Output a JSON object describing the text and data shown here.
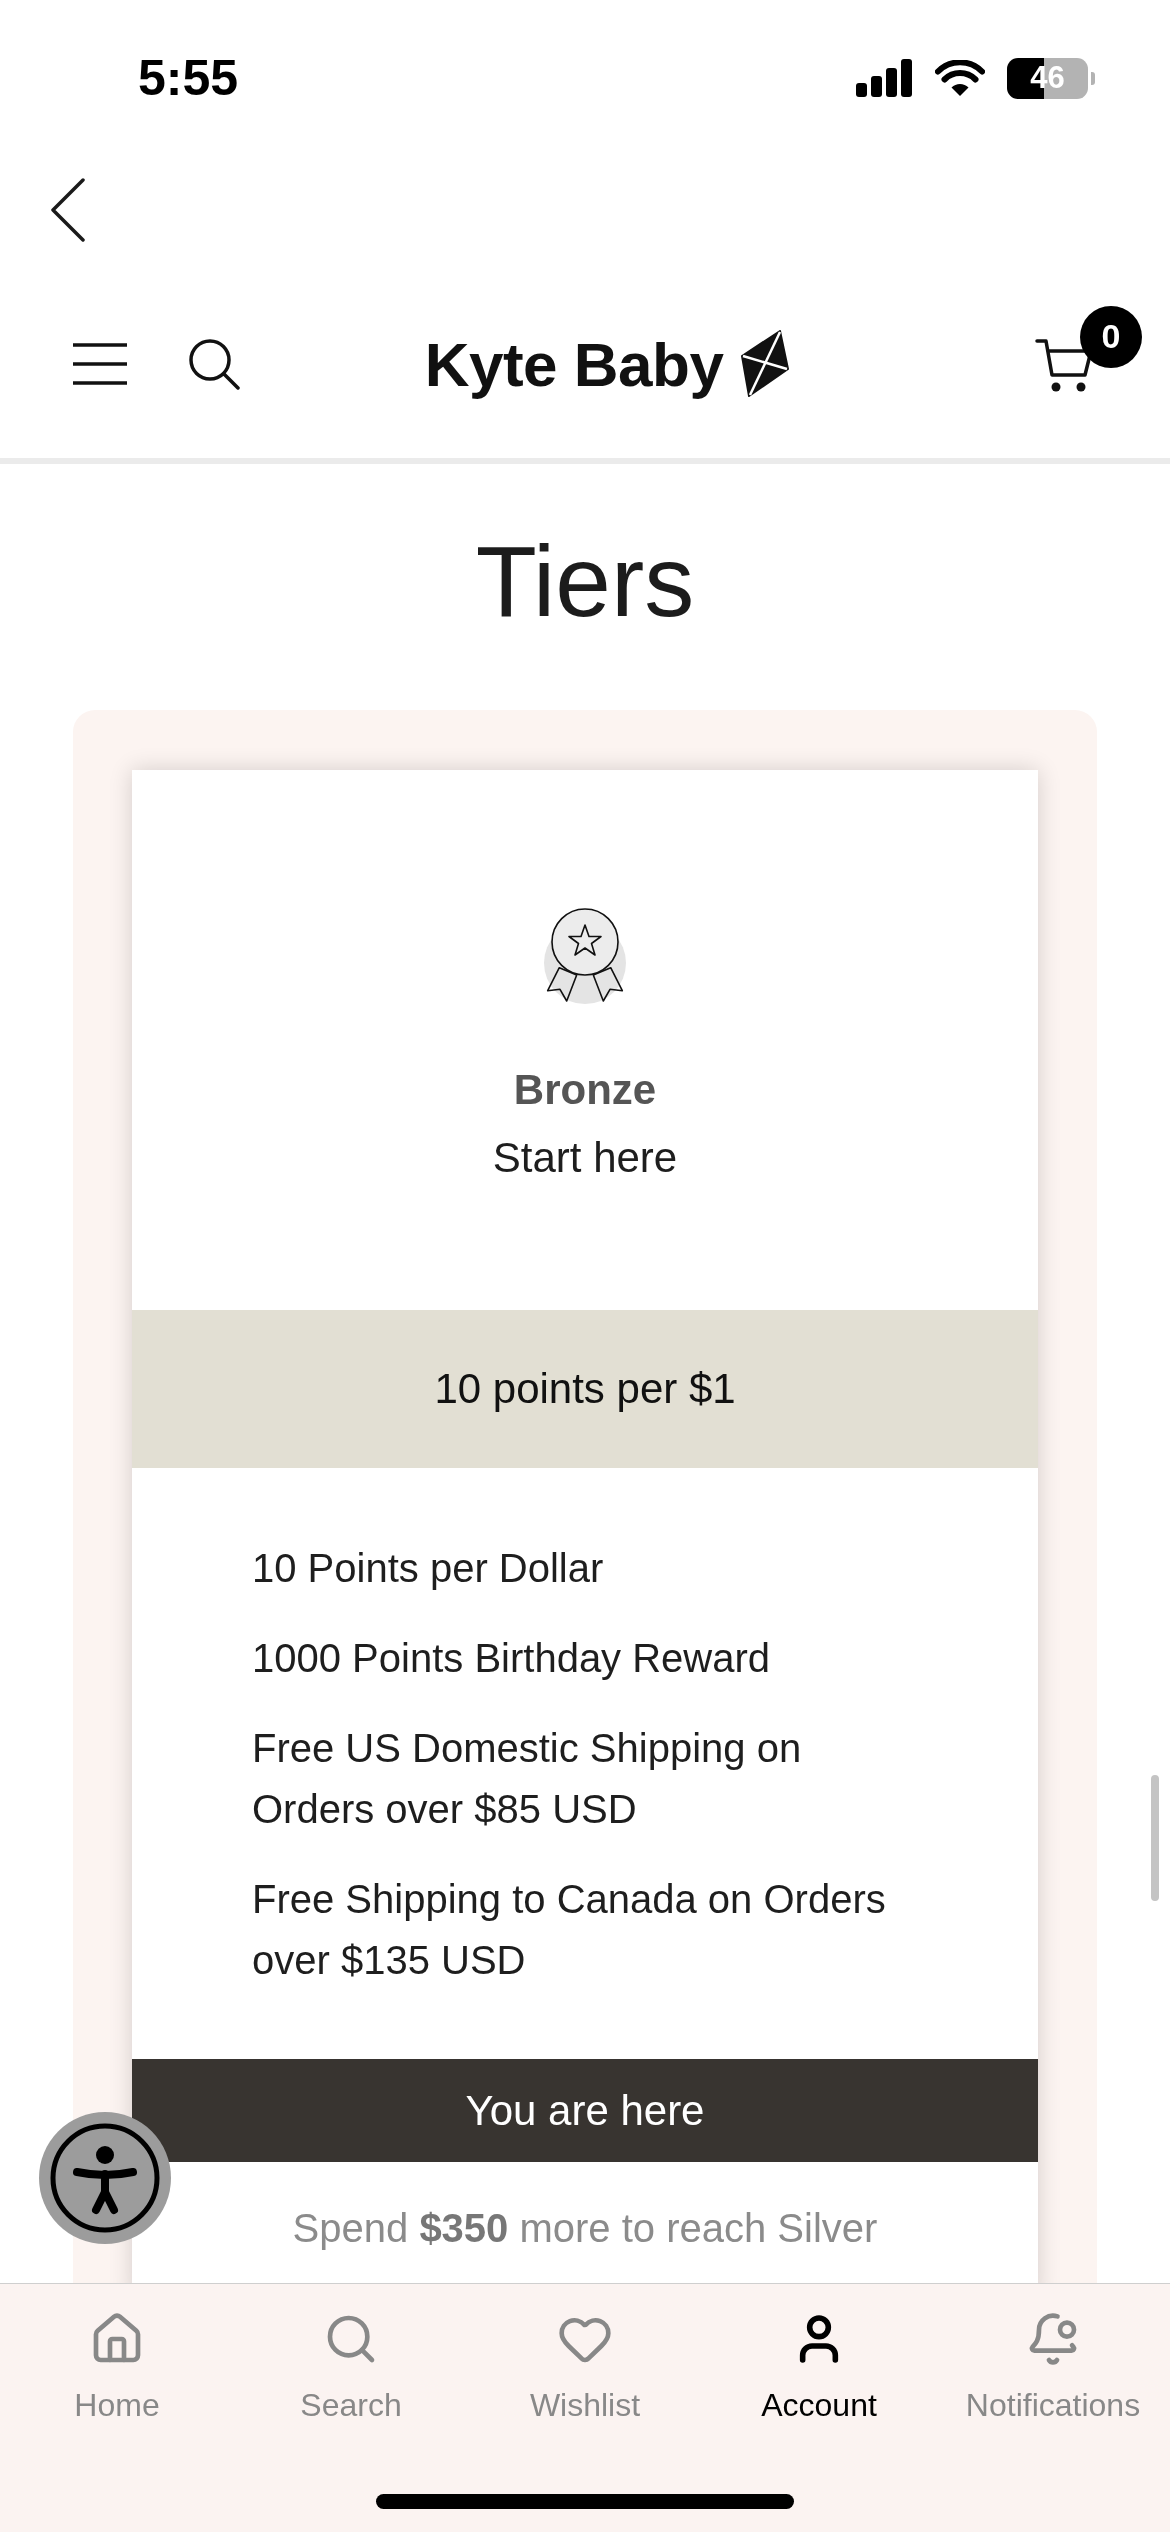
{
  "status_bar": {
    "time": "5:55",
    "battery": "46"
  },
  "header": {
    "logo": "Kyte Baby",
    "cart_count": "0"
  },
  "page_title": "Tiers",
  "tier": {
    "name": "Bronze",
    "subtitle": "Start here",
    "earn_rate": "10 points per $1",
    "benefits": [
      "10 Points per Dollar",
      "1000 Points Birthday Reward",
      "Free US Domestic Shipping on Orders over $85 USD",
      "Free Shipping to Canada on Orders over $135 USD"
    ],
    "status": "You are here",
    "progress_note": "Spend **$350** more to reach Silver"
  },
  "tab_bar": [
    {
      "kind": "home",
      "label": "Home",
      "selected": false
    },
    {
      "kind": "search",
      "label": "Search",
      "selected": false
    },
    {
      "kind": "wishlist",
      "label": "Wishlist",
      "selected": false
    },
    {
      "kind": "account",
      "label": "Account",
      "selected": true
    },
    {
      "kind": "notifications",
      "label": "Notifications",
      "selected": false
    }
  ]
}
